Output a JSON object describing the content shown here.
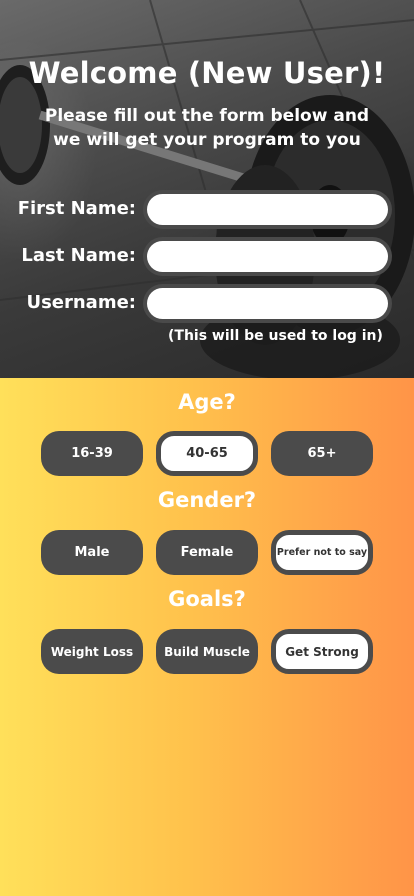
{
  "header": {
    "title": "Welcome (New User)!",
    "subtitle_line1": "Please fill out the form below and",
    "subtitle_line2": "we will get your program to you"
  },
  "form": {
    "first_name": {
      "label": "First Name:",
      "value": ""
    },
    "last_name": {
      "label": "Last Name:",
      "value": ""
    },
    "username": {
      "label": "Username:",
      "value": "",
      "hint": "(This will be used to log in)"
    }
  },
  "age": {
    "title": "Age?",
    "options": [
      "16-39",
      "40-65",
      "65+"
    ],
    "selected": "40-65"
  },
  "gender": {
    "title": "Gender?",
    "options": [
      "Male",
      "Female",
      "Prefer not to say"
    ],
    "selected": "Prefer not to say"
  },
  "goals": {
    "title": "Goals?",
    "options": [
      "Weight Loss",
      "Build Muscle",
      "Get Strong"
    ],
    "selected": "Get Strong"
  },
  "colors": {
    "button_dark": "#4b4b4b",
    "gradient_start": "#ffe05a",
    "gradient_end": "#ff9448",
    "text_white": "#ffffff"
  },
  "icons": {
    "background": "gym-weights-photo"
  }
}
